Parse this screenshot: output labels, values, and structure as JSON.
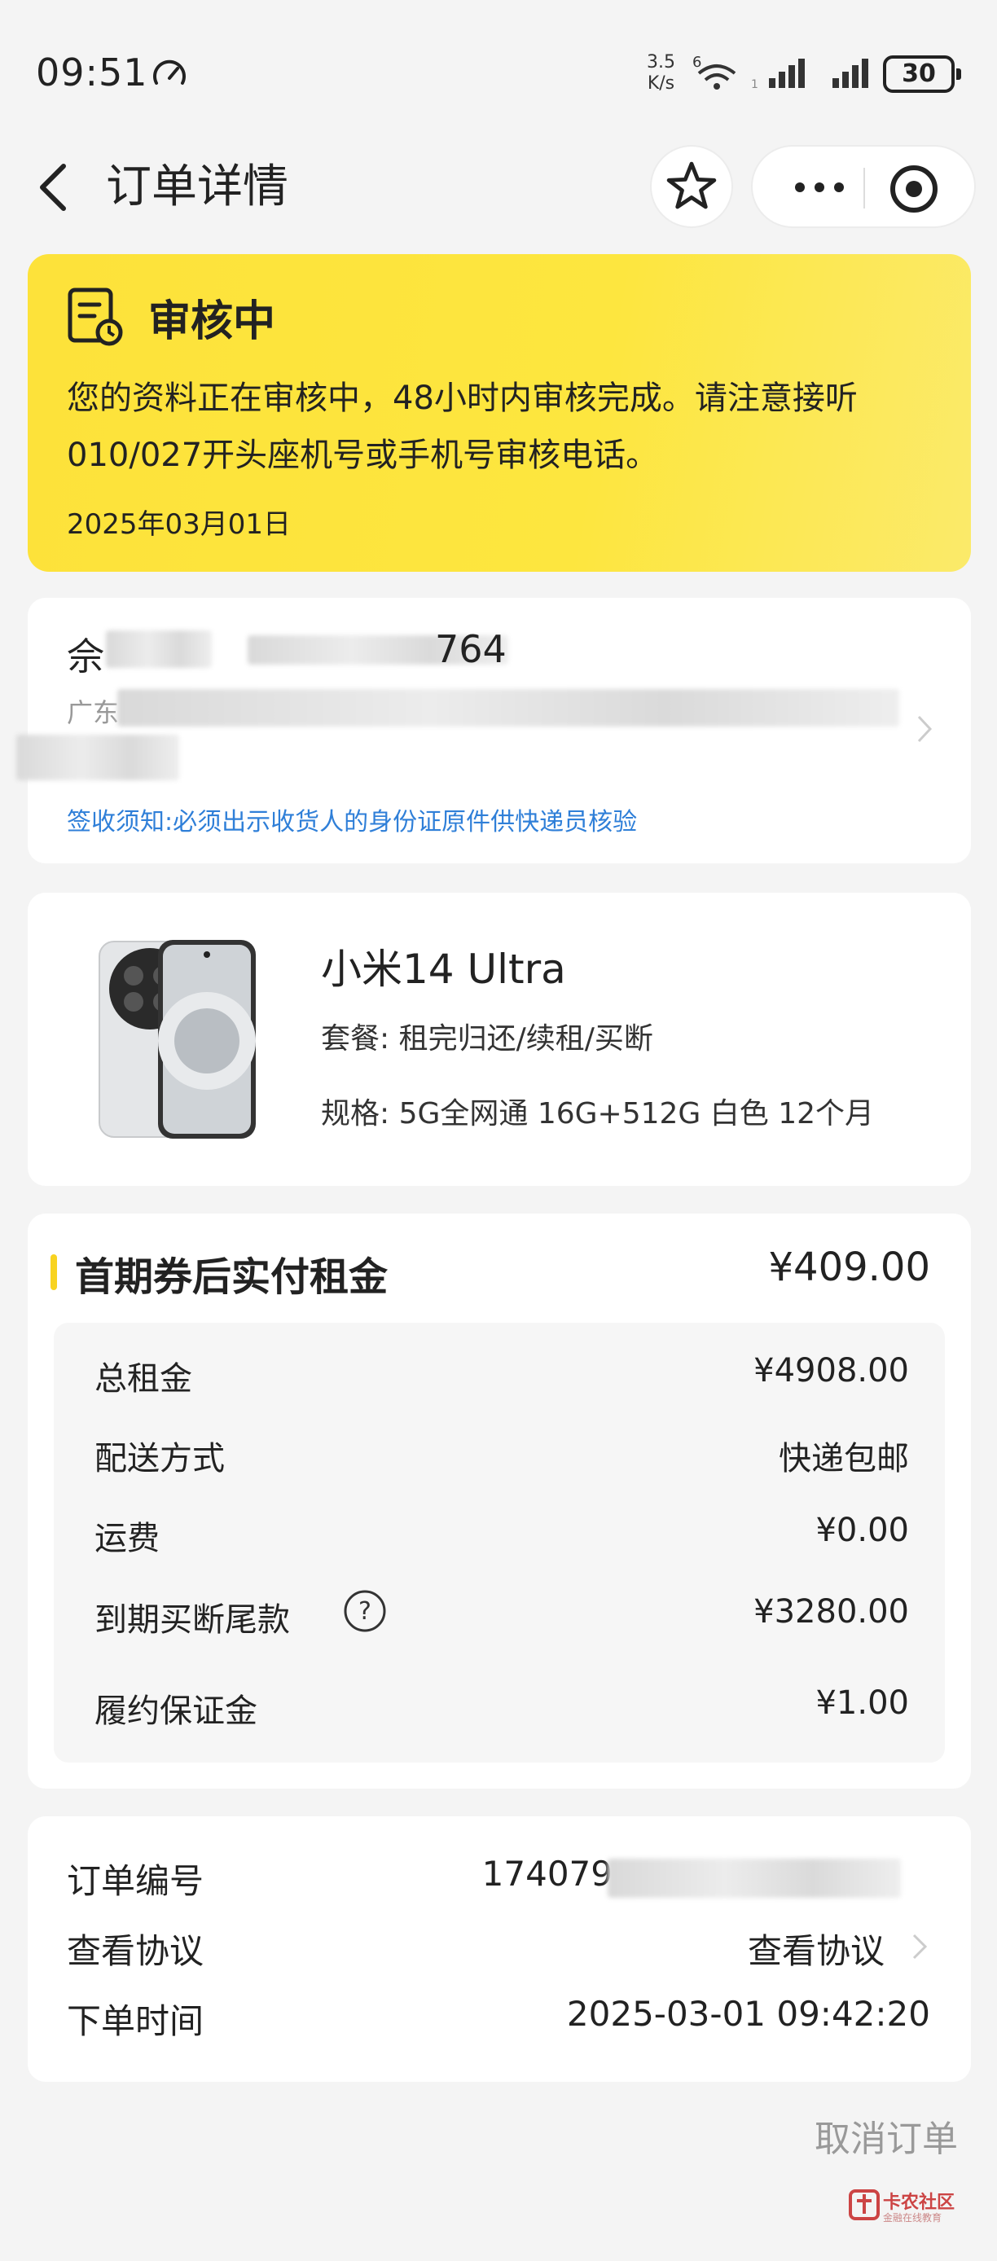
{
  "status_bar": {
    "time": "09:51",
    "net_speed": "3.5",
    "net_unit": "K/s",
    "wifi_tag": "6",
    "battery": "30"
  },
  "header": {
    "title": "订单详情"
  },
  "status_card": {
    "title": "审核中",
    "description": "您的资料正在审核中，48小时内审核完成。请注意接听 010/027开头座机号或手机号审核电话。",
    "date": "2025年03月01日"
  },
  "address": {
    "name": "佘",
    "phone": "764",
    "line1": "广东",
    "line2": "昔",
    "notice": "签收须知:必须出示收货人的身份证原件供快递员核验"
  },
  "product": {
    "name": "小米14 Ultra",
    "plan_label": "套餐:",
    "plan_value": "租完归还/续租/买断",
    "spec_label": "规格:",
    "spec_value": "5G全网通 16G+512G 白色 12个月"
  },
  "payment": {
    "title": "首期券后实付租金",
    "amount": "¥409.00",
    "rows": [
      {
        "label": "总租金",
        "value": "¥4908.00"
      },
      {
        "label": "配送方式",
        "value": "快递包邮"
      },
      {
        "label": "运费",
        "value": "¥0.00"
      },
      {
        "label": "到期买断尾款",
        "value": "¥3280.00"
      },
      {
        "label": "履约保证金",
        "value": "¥1.00"
      }
    ]
  },
  "order_info": {
    "rows": [
      {
        "label": "订单编号",
        "value": "174079"
      },
      {
        "label": "查看协议",
        "value": "查看协议"
      },
      {
        "label": "下单时间",
        "value": "2025-03-01 09:42:20"
      }
    ]
  },
  "footer": {
    "cancel_label": "取消订单",
    "watermark_text": "卡农社区",
    "watermark_sub": "金融在线教育"
  },
  "colors": {
    "status_yellow": "#fde23a",
    "accent_yellow": "#f8d320",
    "link_blue": "#2f7fd8"
  }
}
